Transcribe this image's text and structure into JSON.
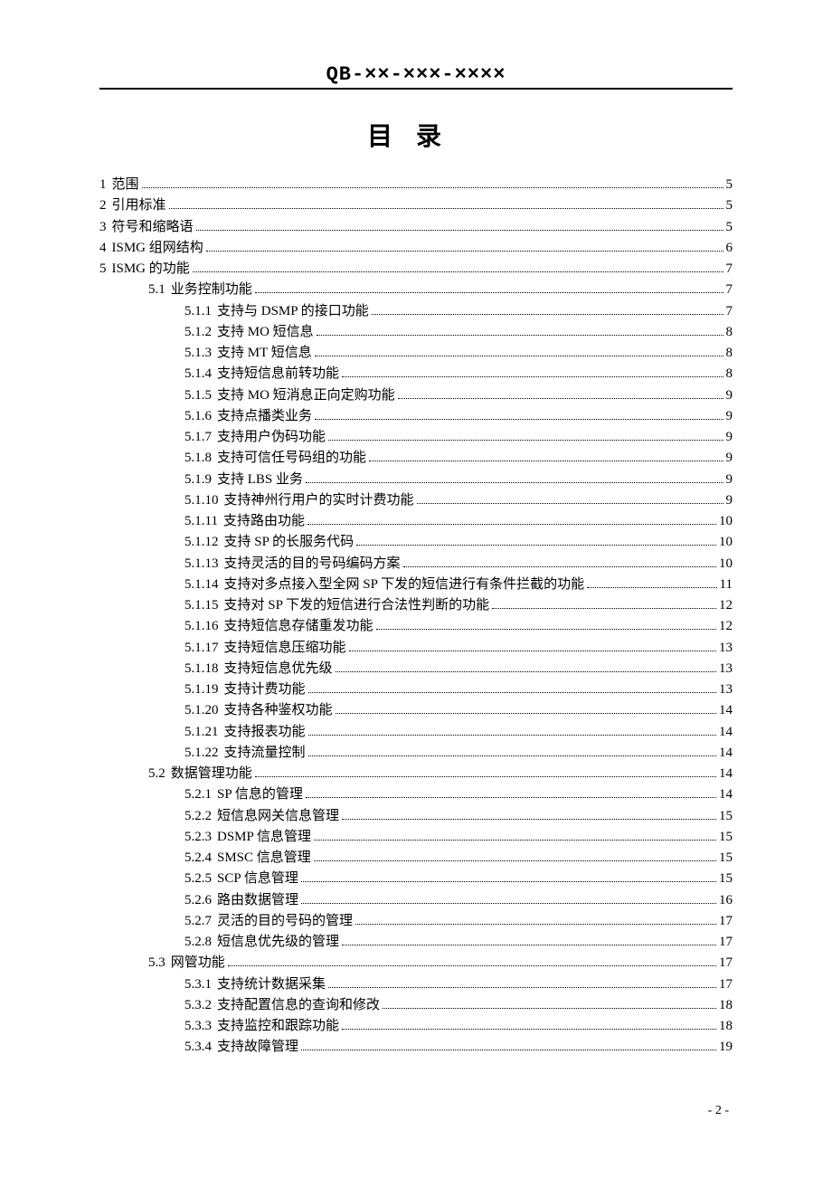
{
  "header_code": "QB-××-×××-××××",
  "title": "目录",
  "footer": "- 2 -",
  "toc": [
    {
      "level": 1,
      "num": "1",
      "label": "范围",
      "page": "5"
    },
    {
      "level": 1,
      "num": "2",
      "label": "引用标准",
      "page": "5"
    },
    {
      "level": 1,
      "num": "3",
      "label": "符号和缩略语",
      "page": "5"
    },
    {
      "level": 1,
      "num": "4",
      "label": "ISMG 组网结构",
      "page": "6"
    },
    {
      "level": 1,
      "num": "5",
      "label": "ISMG 的功能",
      "page": "7"
    },
    {
      "level": 2,
      "num": "5.1",
      "label": "业务控制功能",
      "page": "7"
    },
    {
      "level": 3,
      "num": "5.1.1",
      "label": "支持与 DSMP 的接口功能",
      "page": "7"
    },
    {
      "level": 3,
      "num": "5.1.2",
      "label": "支持 MO 短信息",
      "page": "8"
    },
    {
      "level": 3,
      "num": "5.1.3",
      "label": "支持 MT 短信息",
      "page": "8"
    },
    {
      "level": 3,
      "num": "5.1.4",
      "label": "支持短信息前转功能",
      "page": "8"
    },
    {
      "level": 3,
      "num": "5.1.5",
      "label": "支持 MO 短消息正向定购功能",
      "page": "9"
    },
    {
      "level": 3,
      "num": "5.1.6",
      "label": "支持点播类业务",
      "page": "9"
    },
    {
      "level": 3,
      "num": "5.1.7",
      "label": "支持用户伪码功能",
      "page": "9"
    },
    {
      "level": 3,
      "num": "5.1.8",
      "label": "支持可信任号码组的功能",
      "page": "9"
    },
    {
      "level": 3,
      "num": "5.1.9",
      "label": "支持 LBS 业务",
      "page": "9"
    },
    {
      "level": 3,
      "num": "5.1.10",
      "label": "支持神州行用户的实时计费功能",
      "page": "9"
    },
    {
      "level": 3,
      "num": "5.1.11",
      "label": "支持路由功能",
      "page": "10"
    },
    {
      "level": 3,
      "num": "5.1.12",
      "label": "支持 SP 的长服务代码",
      "page": "10"
    },
    {
      "level": 3,
      "num": "5.1.13",
      "label": "支持灵活的目的号码编码方案",
      "page": "10"
    },
    {
      "level": 3,
      "num": "5.1.14",
      "label": "支持对多点接入型全网 SP 下发的短信进行有条件拦截的功能",
      "page": "11"
    },
    {
      "level": 3,
      "num": "5.1.15",
      "label": "支持对 SP 下发的短信进行合法性判断的功能",
      "page": "12"
    },
    {
      "level": 3,
      "num": "5.1.16",
      "label": "支持短信息存储重发功能",
      "page": "12"
    },
    {
      "level": 3,
      "num": "5.1.17",
      "label": "支持短信息压缩功能",
      "page": "13"
    },
    {
      "level": 3,
      "num": "5.1.18",
      "label": "支持短信息优先级",
      "page": "13"
    },
    {
      "level": 3,
      "num": "5.1.19",
      "label": "支持计费功能",
      "page": "13"
    },
    {
      "level": 3,
      "num": "5.1.20",
      "label": "支持各种鉴权功能",
      "page": "14"
    },
    {
      "level": 3,
      "num": "5.1.21",
      "label": "支持报表功能",
      "page": "14"
    },
    {
      "level": 3,
      "num": "5.1.22",
      "label": "支持流量控制",
      "page": "14"
    },
    {
      "level": 2,
      "num": "5.2",
      "label": "数据管理功能",
      "page": "14"
    },
    {
      "level": 3,
      "num": "5.2.1",
      "label": "SP 信息的管理",
      "page": "14"
    },
    {
      "level": 3,
      "num": "5.2.2",
      "label": "短信息网关信息管理",
      "page": "15"
    },
    {
      "level": 3,
      "num": "5.2.3",
      "label": "DSMP 信息管理",
      "page": "15"
    },
    {
      "level": 3,
      "num": "5.2.4",
      "label": "SMSC 信息管理",
      "page": "15"
    },
    {
      "level": 3,
      "num": "5.2.5",
      "label": "SCP 信息管理",
      "page": "15"
    },
    {
      "level": 3,
      "num": "5.2.6",
      "label": "路由数据管理",
      "page": "16"
    },
    {
      "level": 3,
      "num": "5.2.7",
      "label": "灵活的目的号码的管理",
      "page": "17"
    },
    {
      "level": 3,
      "num": "5.2.8",
      "label": "短信息优先级的管理",
      "page": "17"
    },
    {
      "level": 2,
      "num": "5.3",
      "label": "网管功能",
      "page": "17"
    },
    {
      "level": 3,
      "num": "5.3.1",
      "label": "支持统计数据采集",
      "page": "17"
    },
    {
      "level": 3,
      "num": "5.3.2",
      "label": "支持配置信息的查询和修改",
      "page": "18"
    },
    {
      "level": 3,
      "num": "5.3.3",
      "label": "支持监控和跟踪功能",
      "page": "18"
    },
    {
      "level": 3,
      "num": "5.3.4",
      "label": "支持故障管理",
      "page": "19"
    }
  ]
}
